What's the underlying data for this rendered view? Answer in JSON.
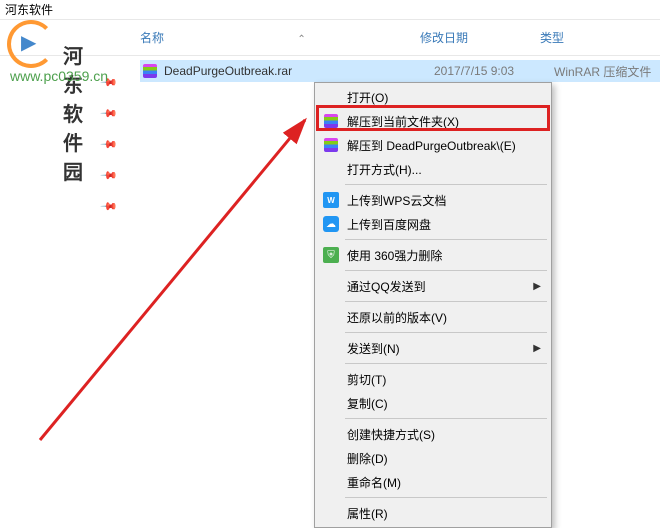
{
  "window": {
    "title": "河东软件"
  },
  "watermark": {
    "text": "河东软件园",
    "url": "www.pc0359.cn"
  },
  "headers": {
    "name": "名称",
    "date": "修改日期",
    "type": "类型"
  },
  "file": {
    "name": "DeadPurgeOutbreak.rar",
    "date": "2017/7/15 9:03",
    "type": "WinRAR 压缩文件"
  },
  "menu": {
    "open": "打开(O)",
    "extract_here": "解压到当前文件夹(X)",
    "extract_to": "解压到 DeadPurgeOutbreak\\(E)",
    "open_with": "打开方式(H)...",
    "wps_cloud": "上传到WPS云文档",
    "baidu_pan": "上传到百度网盘",
    "force_delete": "使用 360强力删除",
    "qq_send": "通过QQ发送到",
    "restore_version": "还原以前的版本(V)",
    "send_to": "发送到(N)",
    "cut": "剪切(T)",
    "copy": "复制(C)",
    "create_shortcut": "创建快捷方式(S)",
    "delete": "删除(D)",
    "rename": "重命名(M)",
    "properties": "属性(R)"
  }
}
